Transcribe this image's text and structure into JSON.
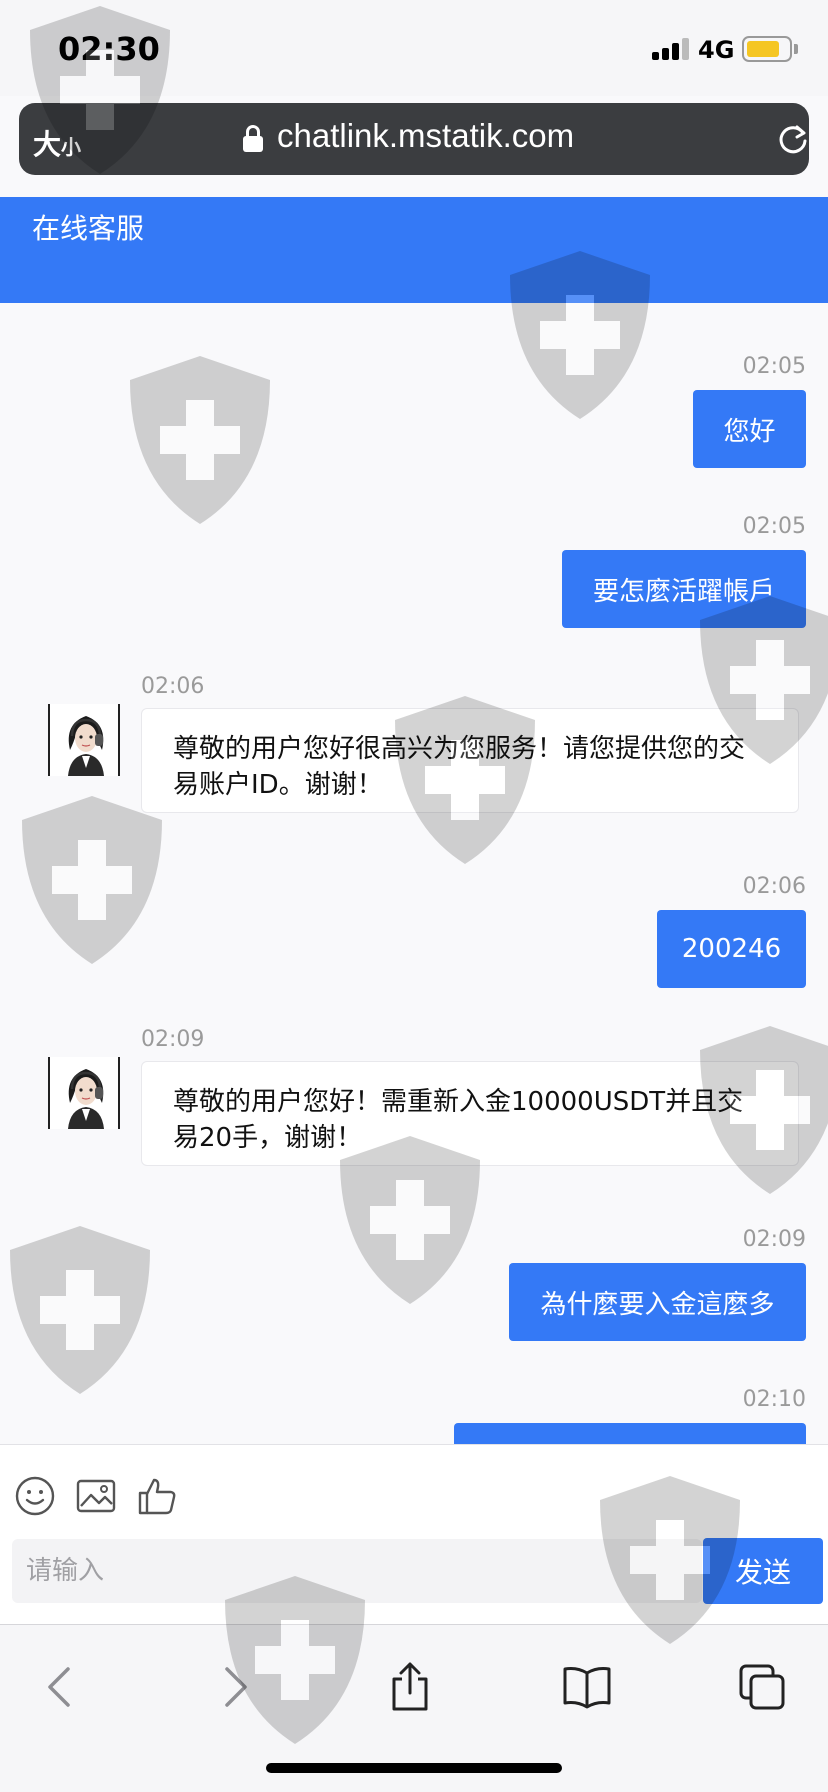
{
  "status_bar": {
    "time": "02:30",
    "network": "4G",
    "battery_level": 0.8
  },
  "browser": {
    "text_size_big": "大",
    "text_size_small": "小",
    "url": "chatlink.mstatik.com"
  },
  "chat": {
    "title": "在线客服",
    "messages": [
      {
        "time": "02:05",
        "direction": "out",
        "text": "您好"
      },
      {
        "time": "02:05",
        "direction": "out",
        "text": "要怎麼活躍帳戶"
      },
      {
        "time": "02:06",
        "direction": "in",
        "text": "尊敬的用户您好很高兴为您服务！请您提供您的交易账户ID。谢谢！"
      },
      {
        "time": "02:06",
        "direction": "out",
        "text": "200246"
      },
      {
        "time": "02:09",
        "direction": "in",
        "text": "尊敬的用户您好！需重新入金10000USDT并且交易20手，谢谢！"
      },
      {
        "time": "02:09",
        "direction": "out",
        "text": "為什麼要入金這麼多"
      },
      {
        "time": "02:10",
        "direction": "out",
        "text": ""
      }
    ]
  },
  "composer": {
    "placeholder": "请输入",
    "send_label": "发送"
  },
  "icons": [
    "emoji-icon",
    "image-icon",
    "thumbs-up-icon",
    "back-icon",
    "forward-icon",
    "share-icon",
    "bookmarks-icon",
    "tabs-icon",
    "lock-icon",
    "reload-icon"
  ],
  "colors": {
    "accent": "#3479f6",
    "header": "#3479f6",
    "battery": "#f5c623"
  }
}
